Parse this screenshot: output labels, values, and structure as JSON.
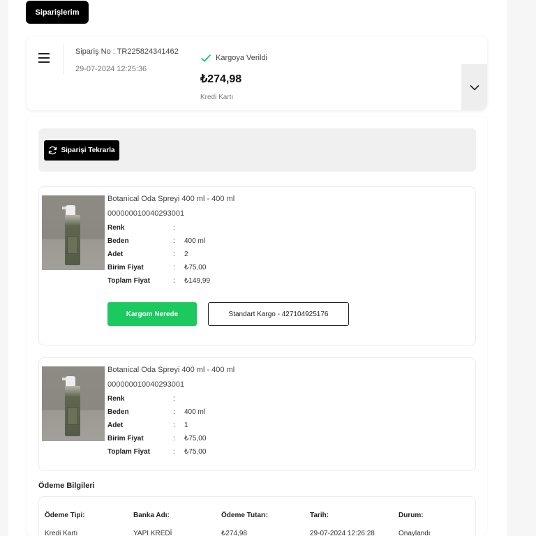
{
  "header": {
    "tab_label": "Siparişlerim"
  },
  "order": {
    "order_no": "Sipariş No : TR225824341462",
    "date": "29-07-2024 12:25:36",
    "status": "Kargoya Verildi",
    "total": "₺274,98",
    "payment_type": "Kredi Kartı",
    "status_color": "#1bc95f"
  },
  "actions": {
    "repeat_label": "Siparişi Tekrarla"
  },
  "products": [
    {
      "name": "Botanical Oda Spreyi 400 ml - 400 ml",
      "sku": "000000010040293001",
      "attrs": [
        {
          "label": "Renk",
          "value": ""
        },
        {
          "label": "Beden",
          "value": "400 ml"
        },
        {
          "label": "Adet",
          "value": "2"
        },
        {
          "label": "Birim Fiyat",
          "value": "₺75,00"
        },
        {
          "label": "Toplam Fiyat",
          "value": "₺149,99"
        }
      ],
      "track_label": "Kargom Nerede",
      "cargo_label": "Standart Kargo - 427104925176"
    },
    {
      "name": "Botanical Oda Spreyi 400 ml - 400 ml",
      "sku": "000000010040293001",
      "attrs": [
        {
          "label": "Renk",
          "value": ""
        },
        {
          "label": "Beden",
          "value": "400 ml"
        },
        {
          "label": "Adet",
          "value": "1"
        },
        {
          "label": "Birim Fiyat",
          "value": "₺75,00"
        },
        {
          "label": "Toplam Fiyat",
          "value": "₺75,00"
        }
      ]
    }
  ],
  "payment": {
    "title": "Ödeme Bilgileri",
    "columns": [
      {
        "header": "Ödeme Tipi:",
        "value": "Kredi Kartı"
      },
      {
        "header": "Banka Adı:",
        "value": "YAPI KREDİ"
      },
      {
        "header": "Ödeme Tutarı:",
        "value": "₺274,98"
      },
      {
        "header": "Tarih:",
        "value": "29-07-2024 12:26:28"
      },
      {
        "header": "Durum:",
        "value": "Onaylandı"
      }
    ]
  },
  "colors": {
    "accent_green": "#1bc95f",
    "primary_black": "#000000"
  },
  "icons": {
    "menu": "hamburger-icon",
    "status": "check-icon",
    "expand": "chevron-down-icon",
    "repeat": "refresh-icon"
  }
}
